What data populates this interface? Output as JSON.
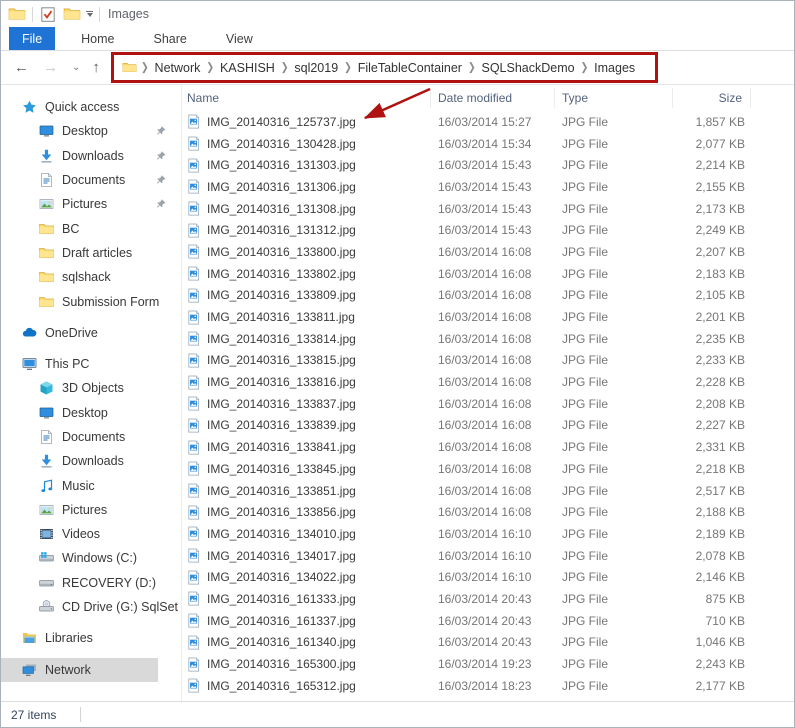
{
  "window": {
    "title": "Images"
  },
  "titlebar": {
    "icons": [
      "folder-icon",
      "checkbox-icon",
      "new-folder-icon",
      "customize-toolbar-dropdown-icon"
    ]
  },
  "tabs": [
    {
      "label": "File",
      "active": true
    },
    {
      "label": "Home",
      "active": false
    },
    {
      "label": "Share",
      "active": false
    },
    {
      "label": "View",
      "active": false
    }
  ],
  "nav": {
    "back": "back-arrow-icon",
    "forward": "forward-arrow-icon",
    "recent": "chevron-down-icon",
    "up": "up-arrow-icon"
  },
  "breadcrumb": {
    "items": [
      "Network",
      "KASHISH",
      "sql2019",
      "FileTableContainer",
      "SQLShackDemo",
      "Images"
    ]
  },
  "columns": [
    "Name",
    "Date modified",
    "Type",
    "Size"
  ],
  "sidebar": {
    "sections": [
      {
        "label": "Quick access",
        "icon": "quick-access-star-icon",
        "children": [
          {
            "label": "Desktop",
            "icon": "desktop-icon",
            "pinned": true
          },
          {
            "label": "Downloads",
            "icon": "downloads-icon",
            "pinned": true
          },
          {
            "label": "Documents",
            "icon": "documents-icon",
            "pinned": true
          },
          {
            "label": "Pictures",
            "icon": "pictures-icon",
            "pinned": true
          },
          {
            "label": "BC",
            "icon": "folder-icon"
          },
          {
            "label": "Draft articles",
            "icon": "folder-icon"
          },
          {
            "label": "sqlshack",
            "icon": "folder-icon"
          },
          {
            "label": "Submission Form",
            "icon": "folder-icon"
          }
        ]
      },
      {
        "label": "OneDrive",
        "icon": "onedrive-cloud-icon",
        "children": []
      },
      {
        "label": "This PC",
        "icon": "computer-icon",
        "children": [
          {
            "label": "3D Objects",
            "icon": "cube-3d-icon"
          },
          {
            "label": "Desktop",
            "icon": "desktop-icon"
          },
          {
            "label": "Documents",
            "icon": "documents-icon"
          },
          {
            "label": "Downloads",
            "icon": "downloads-icon"
          },
          {
            "label": "Music",
            "icon": "music-note-icon"
          },
          {
            "label": "Pictures",
            "icon": "pictures-icon"
          },
          {
            "label": "Videos",
            "icon": "videos-film-icon"
          },
          {
            "label": "Windows (C:)",
            "icon": "drive-windows-icon"
          },
          {
            "label": "RECOVERY (D:)",
            "icon": "drive-icon"
          },
          {
            "label": "CD Drive (G:) SqlSet",
            "icon": "cd-drive-icon"
          }
        ]
      },
      {
        "label": "Libraries",
        "icon": "libraries-icon",
        "children": []
      },
      {
        "label": "Network",
        "icon": "network-icon",
        "selected": true,
        "children": []
      }
    ]
  },
  "files": [
    {
      "name": "IMG_20140316_125737.jpg",
      "date": "16/03/2014 15:27",
      "type": "JPG File",
      "size": "1,857 KB"
    },
    {
      "name": "IMG_20140316_130428.jpg",
      "date": "16/03/2014 15:34",
      "type": "JPG File",
      "size": "2,077 KB"
    },
    {
      "name": "IMG_20140316_131303.jpg",
      "date": "16/03/2014 15:43",
      "type": "JPG File",
      "size": "2,214 KB"
    },
    {
      "name": "IMG_20140316_131306.jpg",
      "date": "16/03/2014 15:43",
      "type": "JPG File",
      "size": "2,155 KB"
    },
    {
      "name": "IMG_20140316_131308.jpg",
      "date": "16/03/2014 15:43",
      "type": "JPG File",
      "size": "2,173 KB"
    },
    {
      "name": "IMG_20140316_131312.jpg",
      "date": "16/03/2014 15:43",
      "type": "JPG File",
      "size": "2,249 KB"
    },
    {
      "name": "IMG_20140316_133800.jpg",
      "date": "16/03/2014 16:08",
      "type": "JPG File",
      "size": "2,207 KB"
    },
    {
      "name": "IMG_20140316_133802.jpg",
      "date": "16/03/2014 16:08",
      "type": "JPG File",
      "size": "2,183 KB"
    },
    {
      "name": "IMG_20140316_133809.jpg",
      "date": "16/03/2014 16:08",
      "type": "JPG File",
      "size": "2,105 KB"
    },
    {
      "name": "IMG_20140316_133811.jpg",
      "date": "16/03/2014 16:08",
      "type": "JPG File",
      "size": "2,201 KB"
    },
    {
      "name": "IMG_20140316_133814.jpg",
      "date": "16/03/2014 16:08",
      "type": "JPG File",
      "size": "2,235 KB"
    },
    {
      "name": "IMG_20140316_133815.jpg",
      "date": "16/03/2014 16:08",
      "type": "JPG File",
      "size": "2,233 KB"
    },
    {
      "name": "IMG_20140316_133816.jpg",
      "date": "16/03/2014 16:08",
      "type": "JPG File",
      "size": "2,228 KB"
    },
    {
      "name": "IMG_20140316_133837.jpg",
      "date": "16/03/2014 16:08",
      "type": "JPG File",
      "size": "2,208 KB"
    },
    {
      "name": "IMG_20140316_133839.jpg",
      "date": "16/03/2014 16:08",
      "type": "JPG File",
      "size": "2,227 KB"
    },
    {
      "name": "IMG_20140316_133841.jpg",
      "date": "16/03/2014 16:08",
      "type": "JPG File",
      "size": "2,331 KB"
    },
    {
      "name": "IMG_20140316_133845.jpg",
      "date": "16/03/2014 16:08",
      "type": "JPG File",
      "size": "2,218 KB"
    },
    {
      "name": "IMG_20140316_133851.jpg",
      "date": "16/03/2014 16:08",
      "type": "JPG File",
      "size": "2,517 KB"
    },
    {
      "name": "IMG_20140316_133856.jpg",
      "date": "16/03/2014 16:08",
      "type": "JPG File",
      "size": "2,188 KB"
    },
    {
      "name": "IMG_20140316_134010.jpg",
      "date": "16/03/2014 16:10",
      "type": "JPG File",
      "size": "2,189 KB"
    },
    {
      "name": "IMG_20140316_134017.jpg",
      "date": "16/03/2014 16:10",
      "type": "JPG File",
      "size": "2,078 KB"
    },
    {
      "name": "IMG_20140316_134022.jpg",
      "date": "16/03/2014 16:10",
      "type": "JPG File",
      "size": "2,146 KB"
    },
    {
      "name": "IMG_20140316_161333.jpg",
      "date": "16/03/2014 20:43",
      "type": "JPG File",
      "size": "875 KB"
    },
    {
      "name": "IMG_20140316_161337.jpg",
      "date": "16/03/2014 20:43",
      "type": "JPG File",
      "size": "710 KB"
    },
    {
      "name": "IMG_20140316_161340.jpg",
      "date": "16/03/2014 20:43",
      "type": "JPG File",
      "size": "1,046 KB"
    },
    {
      "name": "IMG_20140316_165300.jpg",
      "date": "16/03/2014 19:23",
      "type": "JPG File",
      "size": "2,243 KB"
    },
    {
      "name": "IMG_20140316_165312.jpg",
      "date": "16/03/2014 18:23",
      "type": "JPG File",
      "size": "2,177 KB"
    }
  ],
  "status": {
    "items_count": "27 items"
  },
  "colors": {
    "accent_tab": "#1e73d4",
    "annotation_red": "#b01212",
    "selected_bg": "#d9d9d9"
  }
}
